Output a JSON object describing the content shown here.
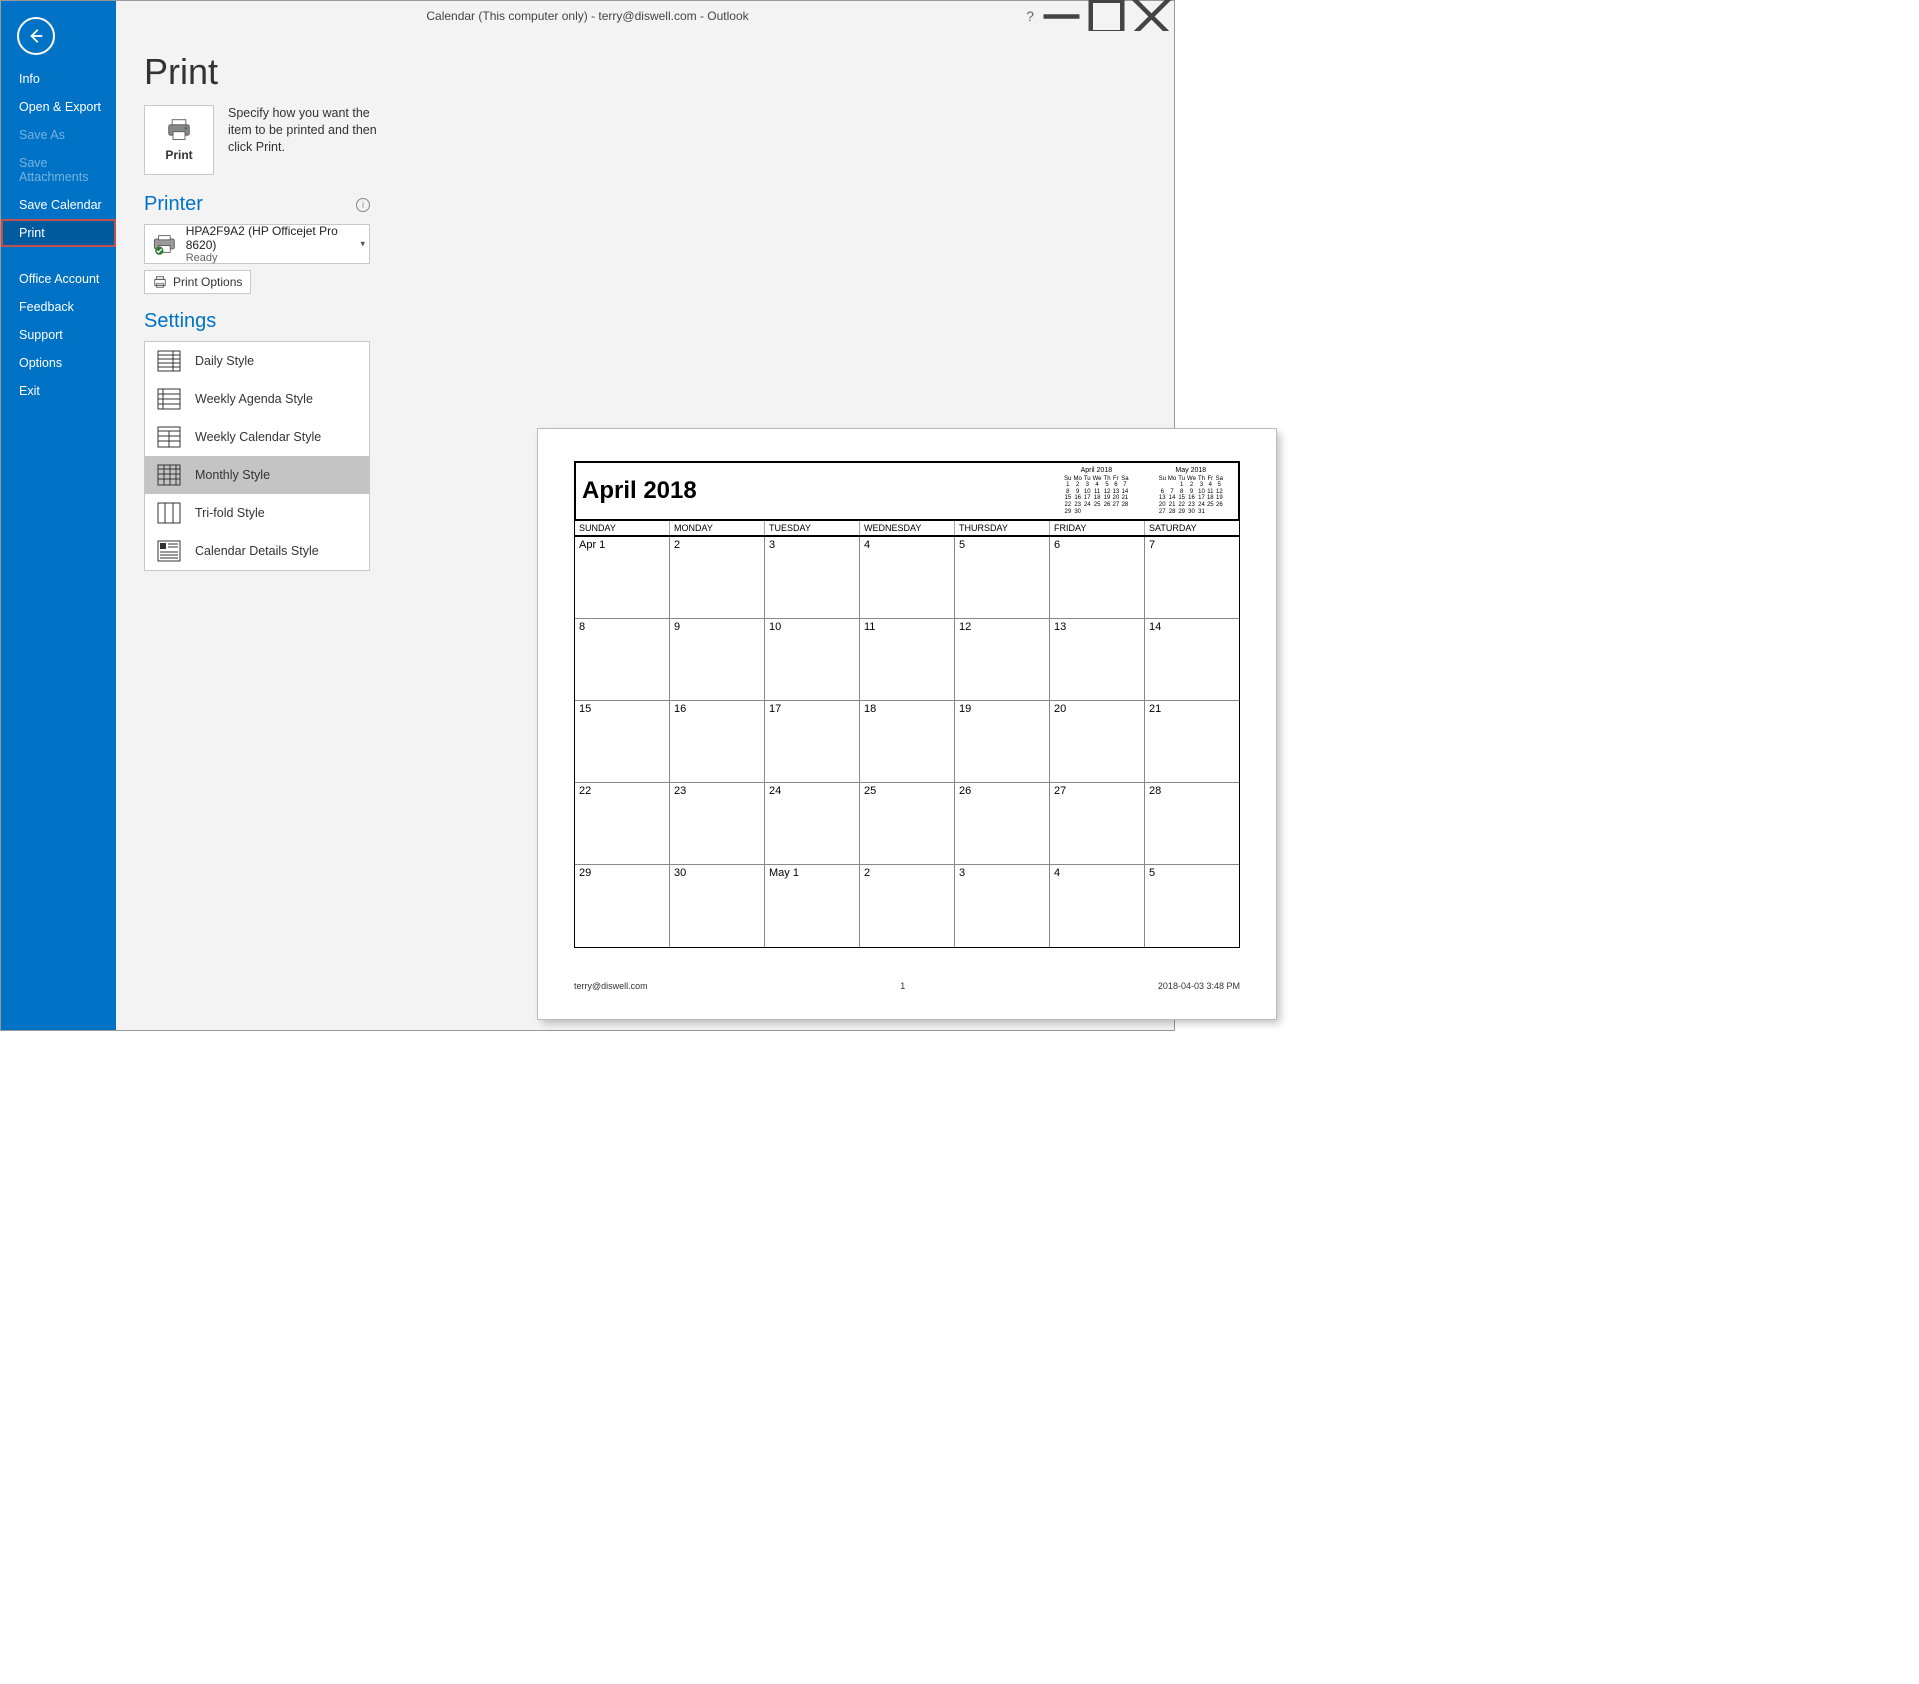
{
  "titlebar": {
    "title": "Calendar (This computer only) - terry@diswell.com  -  Outlook"
  },
  "sidebar": {
    "items": [
      {
        "label": "Info",
        "disabled": false
      },
      {
        "label": "Open & Export",
        "disabled": false
      },
      {
        "label": "Save As",
        "disabled": true
      },
      {
        "label": "Save Attachments",
        "disabled": true
      },
      {
        "label": "Save Calendar",
        "disabled": false
      },
      {
        "label": "Print",
        "disabled": false,
        "selected": true
      },
      {
        "label": "Office Account",
        "disabled": false
      },
      {
        "label": "Feedback",
        "disabled": false
      },
      {
        "label": "Support",
        "disabled": false
      },
      {
        "label": "Options",
        "disabled": false
      },
      {
        "label": "Exit",
        "disabled": false
      }
    ]
  },
  "page": {
    "title": "Print",
    "printBtn": "Print",
    "printDesc": "Specify how you want the item to be printed and then click Print."
  },
  "printer": {
    "section": "Printer",
    "name": "HPA2F9A2 (HP Officejet Pro 8620)",
    "status": "Ready",
    "optionsBtn": "Print Options"
  },
  "settings": {
    "section": "Settings",
    "styles": [
      {
        "label": "Daily Style"
      },
      {
        "label": "Weekly Agenda Style"
      },
      {
        "label": "Weekly Calendar Style"
      },
      {
        "label": "Monthly Style",
        "selected": true
      },
      {
        "label": "Tri-fold Style"
      },
      {
        "label": "Calendar Details Style"
      }
    ]
  },
  "preview": {
    "month_title": "April 2018",
    "day_headers": [
      "SUNDAY",
      "MONDAY",
      "TUESDAY",
      "WEDNESDAY",
      "THURSDAY",
      "FRIDAY",
      "SATURDAY"
    ],
    "weeks": [
      [
        "Apr 1",
        "2",
        "3",
        "4",
        "5",
        "6",
        "7"
      ],
      [
        "8",
        "9",
        "10",
        "11",
        "12",
        "13",
        "14"
      ],
      [
        "15",
        "16",
        "17",
        "18",
        "19",
        "20",
        "21"
      ],
      [
        "22",
        "23",
        "24",
        "25",
        "26",
        "27",
        "28"
      ],
      [
        "29",
        "30",
        "May 1",
        "2",
        "3",
        "4",
        "5"
      ]
    ],
    "footer_left": "terry@diswell.com",
    "footer_center": "1",
    "footer_right": "2018-04-03 3:48 PM",
    "mini": {
      "april": {
        "title": "April 2018",
        "hdr": [
          "Su",
          "Mo",
          "Tu",
          "We",
          "Th",
          "Fr",
          "Sa"
        ],
        "rows": [
          [
            "1",
            "2",
            "3",
            "4",
            "5",
            "6",
            "7"
          ],
          [
            "8",
            "9",
            "10",
            "11",
            "12",
            "13",
            "14"
          ],
          [
            "15",
            "16",
            "17",
            "18",
            "19",
            "20",
            "21"
          ],
          [
            "22",
            "23",
            "24",
            "25",
            "26",
            "27",
            "28"
          ],
          [
            "29",
            "30",
            "",
            "",
            "",
            "",
            ""
          ]
        ]
      },
      "may": {
        "title": "May 2018",
        "hdr": [
          "Su",
          "Mo",
          "Tu",
          "We",
          "Th",
          "Fr",
          "Sa"
        ],
        "rows": [
          [
            "",
            "",
            "1",
            "2",
            "3",
            "4",
            "5"
          ],
          [
            "6",
            "7",
            "8",
            "9",
            "10",
            "11",
            "12"
          ],
          [
            "13",
            "14",
            "15",
            "16",
            "17",
            "18",
            "19"
          ],
          [
            "20",
            "21",
            "22",
            "23",
            "24",
            "25",
            "26"
          ],
          [
            "27",
            "28",
            "29",
            "30",
            "31",
            "",
            ""
          ]
        ]
      }
    }
  }
}
